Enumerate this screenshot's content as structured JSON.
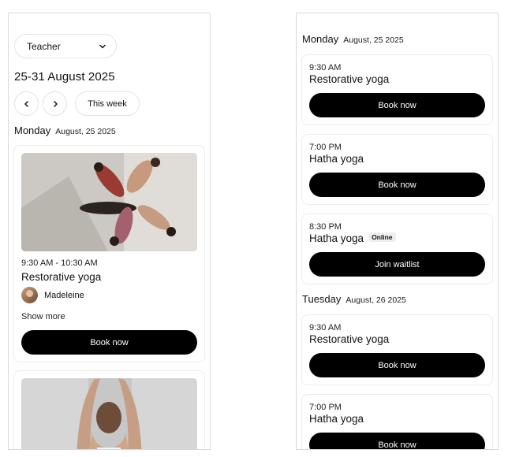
{
  "left": {
    "teacher_filter": {
      "label": "Teacher"
    },
    "date_range": "25-31 August 2025",
    "this_week_label": "This week",
    "day": {
      "name": "Monday",
      "date": "August, 25 2025"
    },
    "card1": {
      "time": "9:30 AM - 10:30 AM",
      "class_name": "Restorative yoga",
      "teacher_name": "Madeleine",
      "show_more": "Show more",
      "button": "Book now"
    }
  },
  "right": {
    "days": [
      {
        "name": "Monday",
        "date": "August, 25 2025",
        "sessions": [
          {
            "time": "9:30 AM",
            "class_name": "Restorative yoga",
            "button": "Book now"
          },
          {
            "time": "7:00 PM",
            "class_name": "Hatha yoga",
            "button": "Book now"
          },
          {
            "time": "8:30 PM",
            "class_name": "Hatha yoga",
            "badge": "Online",
            "button": "Join waitlist"
          }
        ]
      },
      {
        "name": "Tuesday",
        "date": "August, 26 2025",
        "sessions": [
          {
            "time": "9:30 AM",
            "class_name": "Restorative yoga",
            "button": "Book now"
          },
          {
            "time": "7:00 PM",
            "class_name": "Hatha yoga",
            "button": "Book now"
          }
        ]
      }
    ]
  }
}
